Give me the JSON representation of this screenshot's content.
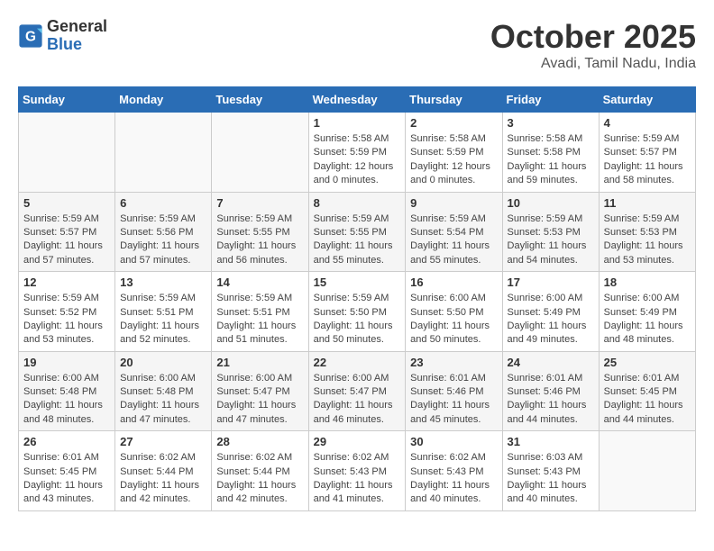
{
  "header": {
    "logo_general": "General",
    "logo_blue": "Blue",
    "month": "October 2025",
    "location": "Avadi, Tamil Nadu, India"
  },
  "days_of_week": [
    "Sunday",
    "Monday",
    "Tuesday",
    "Wednesday",
    "Thursday",
    "Friday",
    "Saturday"
  ],
  "weeks": [
    [
      {
        "day": "",
        "info": ""
      },
      {
        "day": "",
        "info": ""
      },
      {
        "day": "",
        "info": ""
      },
      {
        "day": "1",
        "info": "Sunrise: 5:58 AM\nSunset: 5:59 PM\nDaylight: 12 hours\nand 0 minutes."
      },
      {
        "day": "2",
        "info": "Sunrise: 5:58 AM\nSunset: 5:59 PM\nDaylight: 12 hours\nand 0 minutes."
      },
      {
        "day": "3",
        "info": "Sunrise: 5:58 AM\nSunset: 5:58 PM\nDaylight: 11 hours\nand 59 minutes."
      },
      {
        "day": "4",
        "info": "Sunrise: 5:59 AM\nSunset: 5:57 PM\nDaylight: 11 hours\nand 58 minutes."
      }
    ],
    [
      {
        "day": "5",
        "info": "Sunrise: 5:59 AM\nSunset: 5:57 PM\nDaylight: 11 hours\nand 57 minutes."
      },
      {
        "day": "6",
        "info": "Sunrise: 5:59 AM\nSunset: 5:56 PM\nDaylight: 11 hours\nand 57 minutes."
      },
      {
        "day": "7",
        "info": "Sunrise: 5:59 AM\nSunset: 5:55 PM\nDaylight: 11 hours\nand 56 minutes."
      },
      {
        "day": "8",
        "info": "Sunrise: 5:59 AM\nSunset: 5:55 PM\nDaylight: 11 hours\nand 55 minutes."
      },
      {
        "day": "9",
        "info": "Sunrise: 5:59 AM\nSunset: 5:54 PM\nDaylight: 11 hours\nand 55 minutes."
      },
      {
        "day": "10",
        "info": "Sunrise: 5:59 AM\nSunset: 5:53 PM\nDaylight: 11 hours\nand 54 minutes."
      },
      {
        "day": "11",
        "info": "Sunrise: 5:59 AM\nSunset: 5:53 PM\nDaylight: 11 hours\nand 53 minutes."
      }
    ],
    [
      {
        "day": "12",
        "info": "Sunrise: 5:59 AM\nSunset: 5:52 PM\nDaylight: 11 hours\nand 53 minutes."
      },
      {
        "day": "13",
        "info": "Sunrise: 5:59 AM\nSunset: 5:51 PM\nDaylight: 11 hours\nand 52 minutes."
      },
      {
        "day": "14",
        "info": "Sunrise: 5:59 AM\nSunset: 5:51 PM\nDaylight: 11 hours\nand 51 minutes."
      },
      {
        "day": "15",
        "info": "Sunrise: 5:59 AM\nSunset: 5:50 PM\nDaylight: 11 hours\nand 50 minutes."
      },
      {
        "day": "16",
        "info": "Sunrise: 6:00 AM\nSunset: 5:50 PM\nDaylight: 11 hours\nand 50 minutes."
      },
      {
        "day": "17",
        "info": "Sunrise: 6:00 AM\nSunset: 5:49 PM\nDaylight: 11 hours\nand 49 minutes."
      },
      {
        "day": "18",
        "info": "Sunrise: 6:00 AM\nSunset: 5:49 PM\nDaylight: 11 hours\nand 48 minutes."
      }
    ],
    [
      {
        "day": "19",
        "info": "Sunrise: 6:00 AM\nSunset: 5:48 PM\nDaylight: 11 hours\nand 48 minutes."
      },
      {
        "day": "20",
        "info": "Sunrise: 6:00 AM\nSunset: 5:48 PM\nDaylight: 11 hours\nand 47 minutes."
      },
      {
        "day": "21",
        "info": "Sunrise: 6:00 AM\nSunset: 5:47 PM\nDaylight: 11 hours\nand 47 minutes."
      },
      {
        "day": "22",
        "info": "Sunrise: 6:00 AM\nSunset: 5:47 PM\nDaylight: 11 hours\nand 46 minutes."
      },
      {
        "day": "23",
        "info": "Sunrise: 6:01 AM\nSunset: 5:46 PM\nDaylight: 11 hours\nand 45 minutes."
      },
      {
        "day": "24",
        "info": "Sunrise: 6:01 AM\nSunset: 5:46 PM\nDaylight: 11 hours\nand 44 minutes."
      },
      {
        "day": "25",
        "info": "Sunrise: 6:01 AM\nSunset: 5:45 PM\nDaylight: 11 hours\nand 44 minutes."
      }
    ],
    [
      {
        "day": "26",
        "info": "Sunrise: 6:01 AM\nSunset: 5:45 PM\nDaylight: 11 hours\nand 43 minutes."
      },
      {
        "day": "27",
        "info": "Sunrise: 6:02 AM\nSunset: 5:44 PM\nDaylight: 11 hours\nand 42 minutes."
      },
      {
        "day": "28",
        "info": "Sunrise: 6:02 AM\nSunset: 5:44 PM\nDaylight: 11 hours\nand 42 minutes."
      },
      {
        "day": "29",
        "info": "Sunrise: 6:02 AM\nSunset: 5:43 PM\nDaylight: 11 hours\nand 41 minutes."
      },
      {
        "day": "30",
        "info": "Sunrise: 6:02 AM\nSunset: 5:43 PM\nDaylight: 11 hours\nand 40 minutes."
      },
      {
        "day": "31",
        "info": "Sunrise: 6:03 AM\nSunset: 5:43 PM\nDaylight: 11 hours\nand 40 minutes."
      },
      {
        "day": "",
        "info": ""
      }
    ]
  ]
}
